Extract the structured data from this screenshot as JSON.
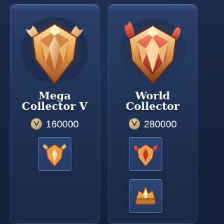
{
  "rewards": [
    {
      "title_line1": "Mega",
      "title_line2": "Collector V",
      "price": "160000",
      "currency_icon": "v-coin-icon",
      "items": [
        "emblem-small-icon"
      ]
    },
    {
      "title_line1": "World",
      "title_line2": "Collector",
      "price": "280000",
      "currency_icon": "v-coin-icon",
      "items": [
        "emblem-small-icon",
        "avatar-border-icon"
      ]
    }
  ],
  "colors": {
    "card": "#233659",
    "gold": "#e6a24a",
    "red": "#c2362b",
    "text": "#ffffff"
  }
}
